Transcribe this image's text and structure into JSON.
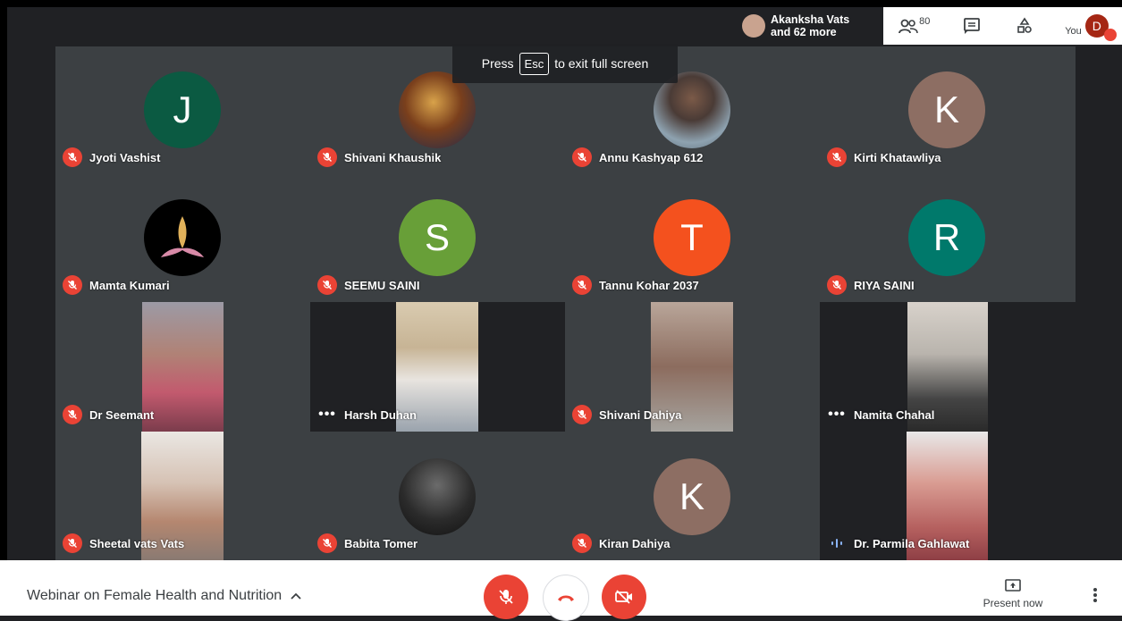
{
  "esc_banner": {
    "press": "Press",
    "key": "Esc",
    "rest": "to exit full screen"
  },
  "topbar": {
    "participant_summary_name": "Akanksha Vats",
    "participant_summary_more": "and 62 more",
    "people_count": "80",
    "you_label": "You",
    "self_initial": "D"
  },
  "participants": [
    {
      "name": "Jyoti Vashist",
      "initial": "J",
      "color": "#0b5a42",
      "mic": "muted"
    },
    {
      "name": "Shivani Khaushik",
      "initial": "",
      "color": "#6b4a22",
      "mic": "muted"
    },
    {
      "name": "Annu Kashyap 612",
      "initial": "",
      "color": "#7a8fa0",
      "mic": "muted"
    },
    {
      "name": "Kirti Khatawliya",
      "initial": "K",
      "color": "#8d6e63",
      "mic": "muted"
    },
    {
      "name": "Mamta Kumari",
      "initial": "",
      "color": "#000000",
      "mic": "muted"
    },
    {
      "name": "SEEMU SAINI",
      "initial": "S",
      "color": "#689f38",
      "mic": "muted"
    },
    {
      "name": "Tannu Kohar 2037",
      "initial": "T",
      "color": "#f4511e",
      "mic": "muted"
    },
    {
      "name": "RIYA SAINI",
      "initial": "R",
      "color": "#00796b",
      "mic": "muted"
    },
    {
      "name": "Dr Seemant",
      "initial": "",
      "color": "#b06a6a",
      "mic": "muted"
    },
    {
      "name": "Harsh Duhan",
      "initial": "",
      "color": "#c9b79c",
      "mic": "idle"
    },
    {
      "name": "Shivani Dahiya",
      "initial": "",
      "color": "#a78f80",
      "mic": "muted"
    },
    {
      "name": "Namita Chahal",
      "initial": "",
      "color": "#b9b4ad",
      "mic": "idle"
    },
    {
      "name": "Sheetal vats Vats",
      "initial": "",
      "color": "#d6c2b4",
      "mic": "muted"
    },
    {
      "name": "Babita Tomer",
      "initial": "",
      "color": "#1a1a1a",
      "mic": "muted"
    },
    {
      "name": "Kiran Dahiya",
      "initial": "K",
      "color": "#8d6e63",
      "mic": "muted"
    },
    {
      "name": "Dr. Parmila Gahlawat",
      "initial": "",
      "color": "#c98c8c",
      "mic": "speaking"
    }
  ],
  "bottombar": {
    "meeting_title": "Webinar on Female Health and Nutrition",
    "present_label": "Present now"
  },
  "colors": {
    "red": "#ea4335",
    "dark": "#202124",
    "tile": "#3c4043"
  }
}
